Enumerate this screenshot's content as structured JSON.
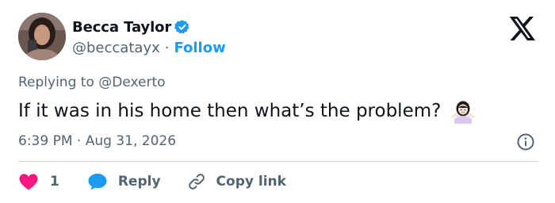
{
  "author": {
    "display_name": "Becca Taylor",
    "handle": "@beccatayx",
    "separator": "·",
    "follow_label": "Follow",
    "verified": true,
    "avatar_icon": "profile-photo"
  },
  "tweet": {
    "replying_to": "Replying to @Dexerto",
    "text": "If it was in his home then what’s the problem?",
    "emoji": "person-shrugging",
    "timestamp": "6:39 PM · Aug 31, 2026"
  },
  "actions": {
    "like_count": "1",
    "reply_label": "Reply",
    "copy_link_label": "Copy link"
  },
  "colors": {
    "accent": "#1d9bf0",
    "like": "#f91880",
    "secondary_text": "#536471",
    "primary_text": "#0f1419",
    "divider": "#cfd9de"
  },
  "icons": {
    "logo": "x-logo-icon",
    "verified": "verified-badge-icon",
    "info": "info-icon",
    "like": "heart-icon",
    "reply": "speech-bubble-icon",
    "copy": "link-icon"
  }
}
